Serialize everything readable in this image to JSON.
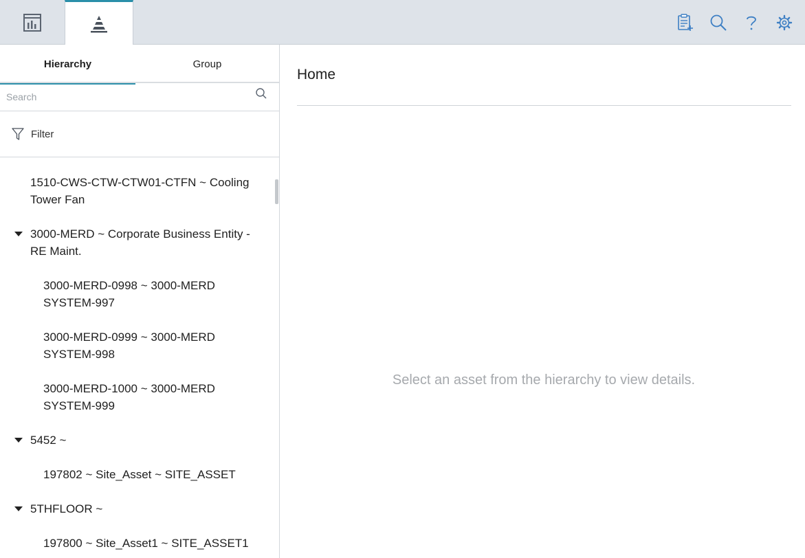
{
  "topbar": {
    "tabs": [
      {
        "icon": "dashboard-icon"
      },
      {
        "icon": "hierarchy-pyramid-icon",
        "active": true
      }
    ],
    "actions": [
      {
        "icon": "clipboard-add-icon"
      },
      {
        "icon": "search-icon"
      },
      {
        "icon": "help-icon"
      },
      {
        "icon": "gear-icon"
      }
    ],
    "accent_color": "#2b8fa9",
    "icon_color": "#3d7fc4"
  },
  "left_panel": {
    "tabs": [
      {
        "label": "Hierarchy",
        "active": true
      },
      {
        "label": "Group",
        "active": false
      }
    ],
    "search": {
      "placeholder": "Search",
      "value": ""
    },
    "filter": {
      "label": "Filter"
    },
    "tree": [
      {
        "text": "1510-CWS-CTW-CTW01-CTFN ~ Cooling Tower Fan",
        "level": 0,
        "expanded": null
      },
      {
        "text": "3000-MERD ~ Corporate Business Entity - RE Maint.",
        "level": 0,
        "expanded": true
      },
      {
        "text": "3000-MERD-0998 ~ 3000-MERD SYSTEM-997",
        "level": 1,
        "expanded": null
      },
      {
        "text": "3000-MERD-0999 ~ 3000-MERD SYSTEM-998",
        "level": 1,
        "expanded": null
      },
      {
        "text": "3000-MERD-1000 ~ 3000-MERD SYSTEM-999",
        "level": 1,
        "expanded": null
      },
      {
        "text": "5452 ~",
        "level": 0,
        "expanded": true
      },
      {
        "text": "197802 ~ Site_Asset ~ SITE_ASSET",
        "level": 1,
        "expanded": null
      },
      {
        "text": "5THFLOOR ~",
        "level": 0,
        "expanded": true
      },
      {
        "text": "197800 ~ Site_Asset1 ~ SITE_ASSET1",
        "level": 1,
        "expanded": null
      }
    ]
  },
  "main": {
    "title": "Home",
    "empty_message": "Select an asset from the hierarchy to view details."
  }
}
